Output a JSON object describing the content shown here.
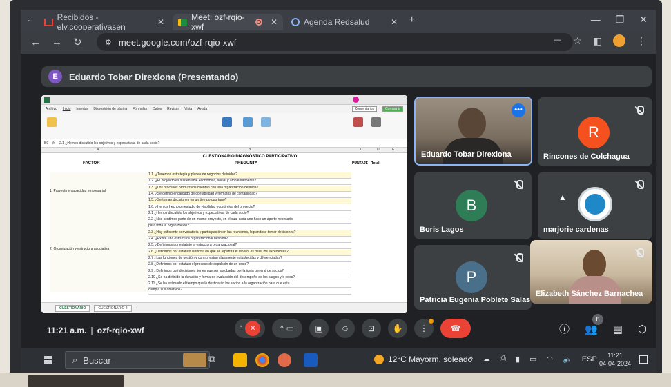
{
  "browser": {
    "tabs": [
      {
        "label": "Recibidos - ely.cooperativasen",
        "icon": "gmail-icon",
        "active": false
      },
      {
        "label": "Meet: ozf-rqio-xwf",
        "icon": "meet-icon",
        "active": true
      },
      {
        "label": "Agenda Redsalud",
        "icon": "agenda-icon",
        "active": false
      }
    ],
    "url": "meet.google.com/ozf-rqio-xwf"
  },
  "meet": {
    "presenter_initial": "E",
    "presenter_banner": "Eduardo Tobar Direxiona (Presentando)",
    "meeting_code": "ozf-rqio-xwf",
    "time": "11:21 a.m.",
    "separator": "|",
    "people_count": "8",
    "participants": [
      {
        "name": "Eduardo Tobar Direxiona",
        "initial": "",
        "type": "video"
      },
      {
        "name": "Rincones de Colchagua",
        "initial": "R",
        "color": "#f4511e",
        "muted": true
      },
      {
        "name": "Boris Lagos",
        "initial": "B",
        "color": "#2e7d57",
        "muted": true
      },
      {
        "name": "marjorie cardenas",
        "initial": "",
        "type": "logo",
        "muted": true
      },
      {
        "name": "Patricia Eugenia Poblete Salas",
        "initial": "P",
        "color": "#4a6f8a",
        "muted": true
      },
      {
        "name": "Elizabeth Sánchez Barnachea",
        "initial": "",
        "type": "video",
        "muted": true
      }
    ]
  },
  "excel": {
    "formula": "2.1 ¿Hemos discutido los objetivos y expectativas de cada socio?",
    "cell_ref": "B9",
    "header_title": "CUESTIONARIO DIAGNÓSTICO PARTICIPATIVO",
    "col_factor": "FACTOR",
    "col_pregunta": "PREGUNTA",
    "col_puntaje": "PUNTAJE",
    "col_total": "Total",
    "factors": [
      "1. Proyecto y capacidad empresarial",
      "2. Organización y estructura asociativa"
    ],
    "rows": [
      "1.1. ¿Tenemos estrategia y planes de negocios definidos?",
      "1.2. ¿El proyecto es sustentable económica, social y ambientalmente?",
      "1.3. ¿Los procesos productivos cuentan con una organización definida?",
      "1.4. ¿Se definió encargado de contabilidad y formatos de contabilidad?",
      "1.5. ¿Se toman decisiones en un tiempo oportuno?",
      "1.6. ¿Hemos hecho un estudio de viabilidad económica del proyecto?",
      "2.1 ¿Hemos discutido los objetivos y expectativas de cada socio?",
      "2.2 ¿Nos sentimos parte de un mismo proyecto, en el cual cada uno hace un aporte necesario",
      "para toda la organización?",
      "2.3 ¿Hay suficiente convocatoria y participación en las reuniones, lograndose tomar decisiones?",
      "2.4. ¿Existe una estructura organizacional definida?",
      "2.5. ¿Definimos por estatuto la estructura organizacional?",
      "2.6 ¿Definimos por estatuto la forma en que se repartirá el dinero, es decir los excedentes?",
      "2.7 ¿Las funciones de gestión y control están claramente establecidas y diferenciadas?",
      "2.8 ¿Definimos por estatuto el proceso de expulsión de un socio?",
      "2.9 ¿Definimos qué decisiones tienen que ser aprobadas por la junta general de socios?",
      "2.10 ¿Se ha definido la duración y forma de evaluación del desempeño de los cargos y/o roles?",
      "2.11 ¿Se ha estimado el tiempo que le destinarán los socios a la organización para que esta",
      "cumpla sus objetivos?"
    ],
    "sheets": [
      "CUESTIONARIO",
      "CUESTIONARIO 2"
    ],
    "comments_btn": "Comentarios",
    "share_btn": "Compartir",
    "menu": [
      "Archivo",
      "Inicio",
      "Insertar",
      "Disposición de página",
      "Fórmulas",
      "Datos",
      "Revisar",
      "Vista",
      "Ayuda"
    ]
  },
  "taskbar": {
    "search_placeholder": "Buscar",
    "weather": "12°C  Mayorm. soleado",
    "lang": "ESP",
    "clock_time": "11:21",
    "clock_date": "04-04-2024"
  }
}
